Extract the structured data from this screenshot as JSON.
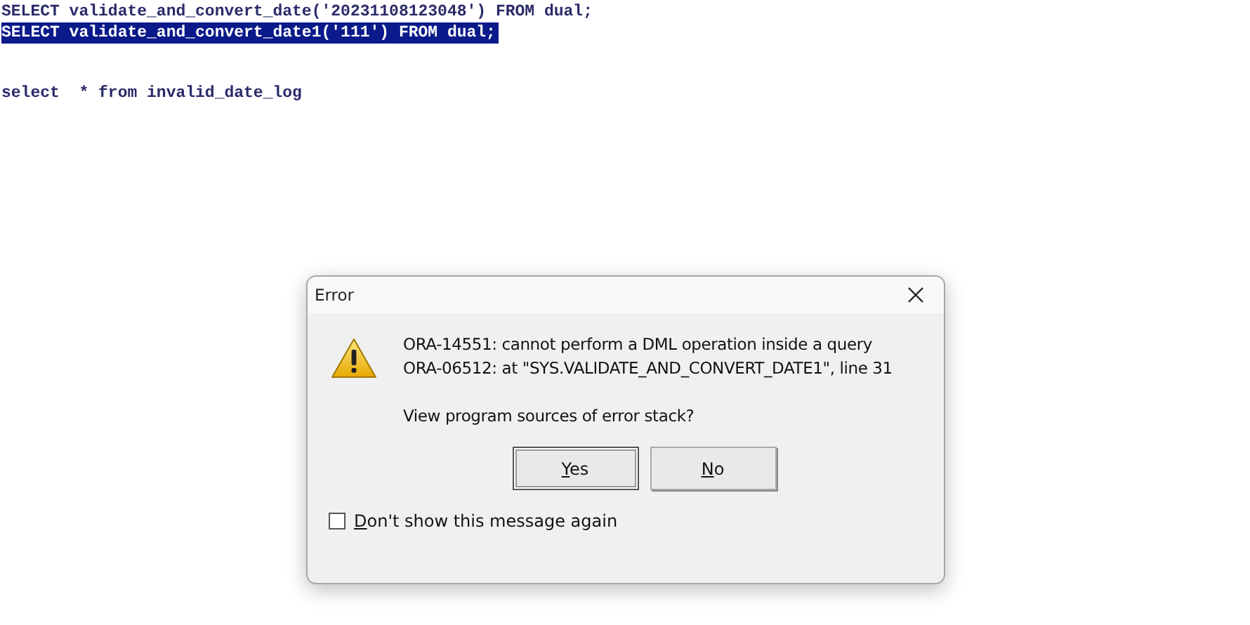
{
  "editor": {
    "statements": [
      [
        {
          "text": "SELECT validate_and_convert_date('20231108123048') FROM dual;",
          "selected": false
        },
        {
          "text": "SELECT validate_and_convert_date1('111') FROM dual;",
          "selected": true
        }
      ],
      [
        {
          "text": "select  * from invalid_date_log",
          "selected": false
        }
      ]
    ]
  },
  "dialog": {
    "title": "Error",
    "messages": [
      "ORA-14551: cannot perform a DML operation inside a query",
      "ORA-06512: at \"SYS.VALIDATE_AND_CONVERT_DATE1\", line 31"
    ],
    "question": "View program sources of error stack?",
    "buttons": [
      {
        "label": "Yes",
        "focused": true
      },
      {
        "label": "No",
        "focused": false
      }
    ],
    "checkbox": {
      "label": "Don't show this message again",
      "checked": false
    }
  }
}
